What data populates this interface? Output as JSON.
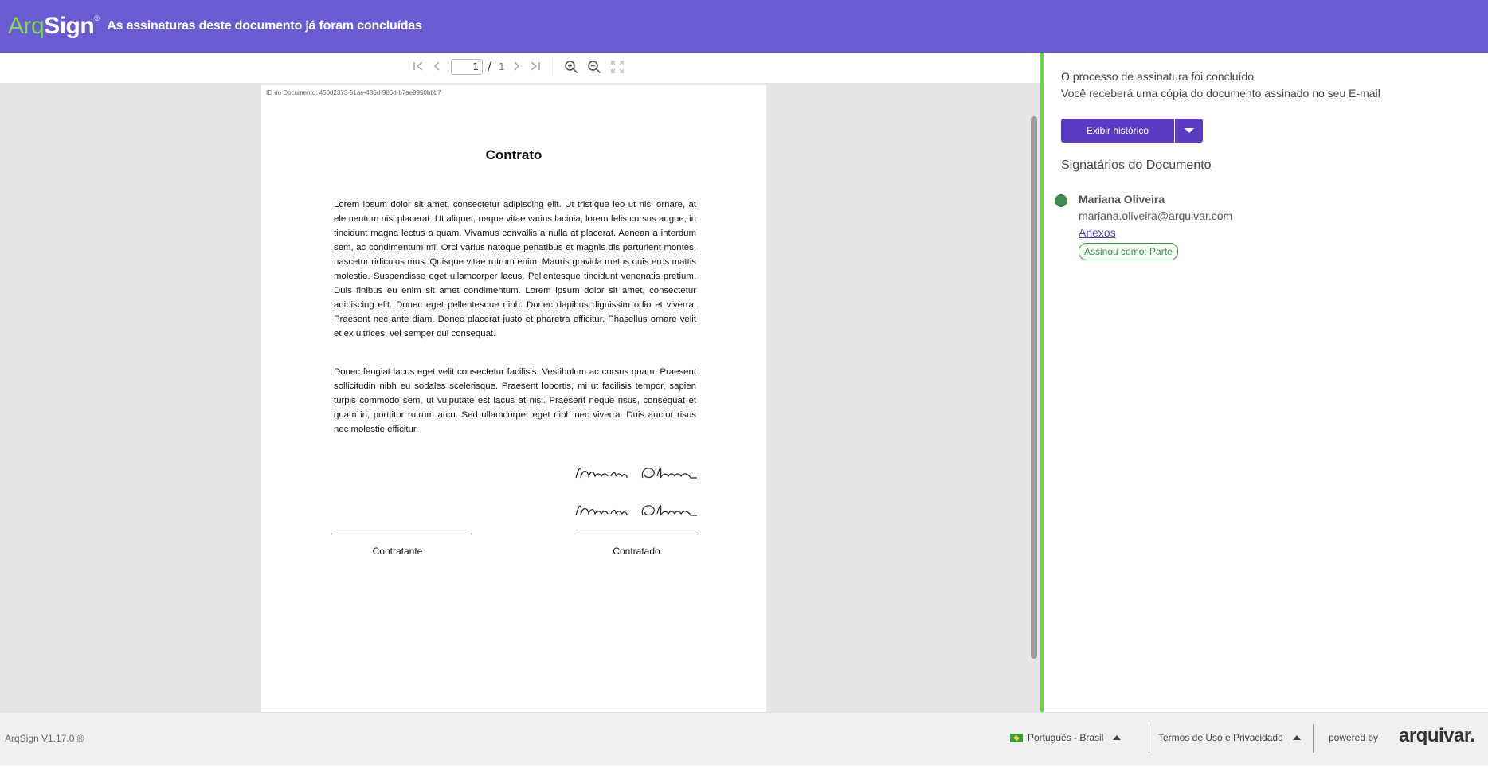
{
  "header": {
    "logo_arq": "Arq",
    "logo_sign": "Sign",
    "logo_mark": "®",
    "title": "As assinaturas deste documento já foram concluídas"
  },
  "toolbar": {
    "first_icon": "⏮",
    "prev_icon": "‹",
    "page_value": "1",
    "page_sep": "/",
    "page_total": "1",
    "next_icon": "›",
    "last_icon": "⏭",
    "zoom_in_icon": "zoom-in-icon",
    "zoom_out_icon": "zoom-out-icon",
    "fullscreen_icon": "fullscreen-icon"
  },
  "document": {
    "id_text": "ID do Documento: 450d2373-51ae-486d-986d-b7ae9950bbb7",
    "title": "Contrato",
    "paragraph1": "Lorem ipsum dolor sit amet, consectetur adipiscing elit. Ut tristique leo ut nisi ornare, at elementum nisi placerat. Ut aliquet, neque vitae varius lacinia, lorem felis cursus augue, in tincidunt magna lectus a quam. Vivamus convallis a nulla at placerat. Aenean a interdum sem, ac condimentum mi. Orci varius natoque penatibus et magnis dis parturient montes, nascetur ridiculus mus. Quisque vitae rutrum enim. Mauris gravida metus quis eros mattis molestie. Suspendisse eget ullamcorper lacus. Pellentesque tincidunt venenatis pretium. Duis finibus eu enim sit amet condimentum. Lorem ipsum dolor sit amet, consectetur adipiscing elit. Donec eget pellentesque nibh. Donec dapibus dignissim odio et viverra. Praesent nec ante diam. Donec placerat justo et pharetra efficitur. Phasellus ornare velit et ex ultrices, vel semper dui consequat.",
    "paragraph2": "Donec feugiat lacus eget velit consectetur facilisis. Vestibulum ac cursus quam. Praesent sollicitudin nibh eu sodales scelerisque. Praesent lobortis, mi ut facilisis tempor, sapien turpis commodo sem, ut vulputate est lacus at nisi. Praesent neque risus, consequat et quam in, porttitor rutrum arcu. Sed ullamcorper eget nibh nec viverra. Duis auctor risus nec molestie efficitur.",
    "signature_text": "Mariana Oliveira",
    "label_left": "Contratante",
    "label_right": "Contratado"
  },
  "panel": {
    "status_line1": "O processo de assinatura foi concluído",
    "status_line2": "Você receberá uma cópia do documento assinado no seu E-mail",
    "history_button": "Exibir histórico",
    "signers_title": "Signatários do Documento",
    "signer": {
      "name": "Mariana Oliveira",
      "email": "mariana.oliveira@arquivar.com",
      "attachments_link": "Anexos",
      "badge": "Assinou como: Parte",
      "status_color": "#3f8a4f"
    }
  },
  "footer": {
    "version": "ArqSign V1.17.0 ®",
    "language": "Português - Brasil",
    "terms": "Termos de Uso e Privacidade",
    "powered_by": "powered by",
    "brand": "arquivar."
  },
  "colors": {
    "header_bg": "#6b5bd2",
    "accent": "#5a3cc3",
    "divider_green": "#6fd24a",
    "logo_green": "#7ed957"
  }
}
